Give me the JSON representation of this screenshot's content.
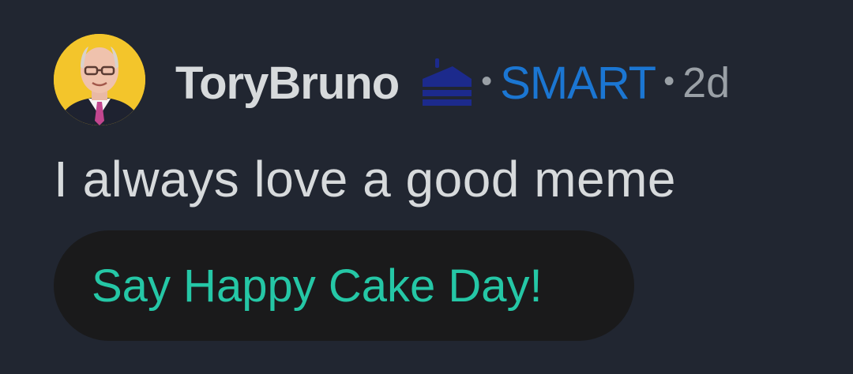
{
  "comment": {
    "author": "ToryBruno",
    "author_icon": "cake-icon",
    "flair": "SMART",
    "separator": "•",
    "age": "2d",
    "body": "I always love a good meme",
    "action_button_label": "Say Happy Cake Day!"
  },
  "colors": {
    "background": "#212631",
    "username": "#d7dadc",
    "flair": "#1b76d2",
    "cake_icon": "#1c2a8c",
    "action_text": "#25c7a6",
    "action_bg": "#1a1a1b"
  }
}
